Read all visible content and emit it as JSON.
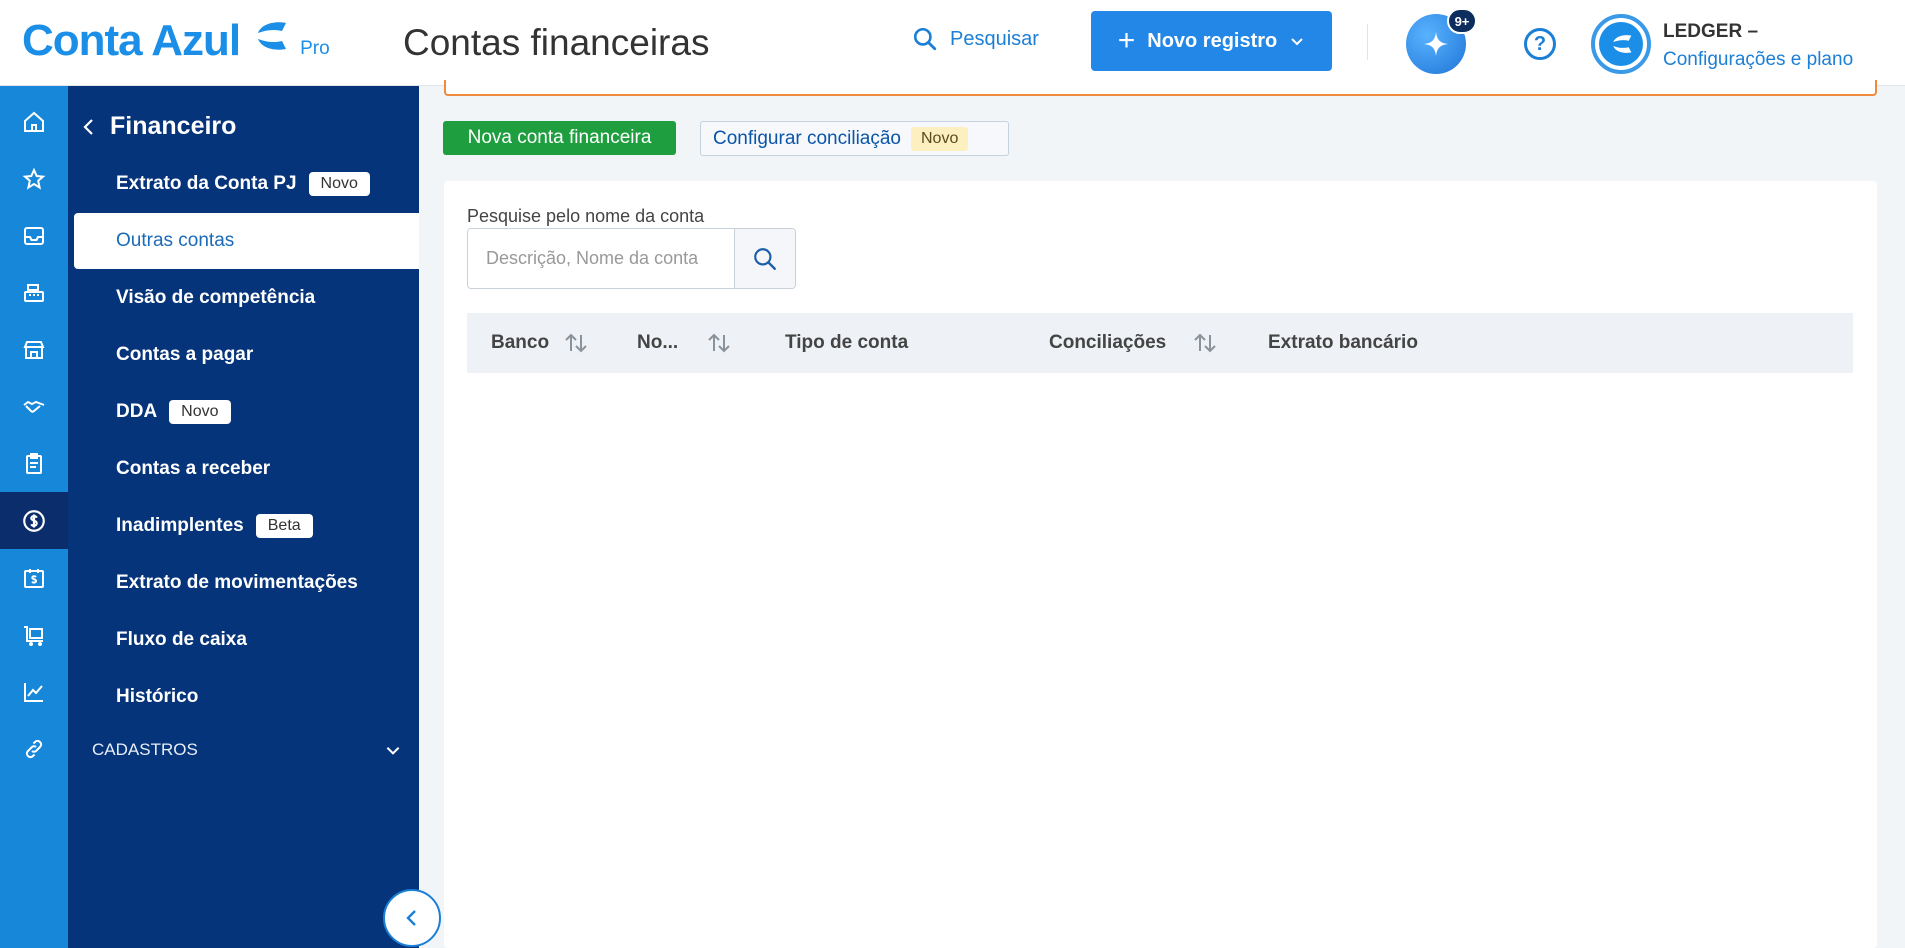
{
  "brand": {
    "name": "Conta Azul",
    "plan": "Pro"
  },
  "header": {
    "title": "Contas financeiras",
    "search_label": "Pesquisar",
    "new_record_label": "Novo registro",
    "ai_badge": "9+",
    "help_symbol": "?",
    "user_name": "LEDGER –",
    "user_link": "Configurações e plano"
  },
  "rail": {
    "icons": [
      "home-icon",
      "star-icon",
      "inbox-icon",
      "cash-register-icon",
      "store-icon",
      "handshake-icon",
      "clipboard-icon",
      "dollar-circle-icon",
      "calendar-dollar-icon",
      "cart-icon",
      "chart-icon",
      "link-icon"
    ],
    "active": "dollar-circle-icon"
  },
  "sidebar": {
    "title": "Financeiro",
    "items": [
      {
        "label": "Extrato da Conta PJ",
        "badge": "Novo"
      },
      {
        "label": "Outras contas",
        "badge": ""
      },
      {
        "label": "Visão de competência",
        "badge": ""
      },
      {
        "label": "Contas a pagar",
        "badge": ""
      },
      {
        "label": "DDA",
        "badge": "Novo"
      },
      {
        "label": "Contas a receber",
        "badge": ""
      },
      {
        "label": "Inadimplentes",
        "badge": "Beta"
      },
      {
        "label": "Extrato de movimentações",
        "badge": ""
      },
      {
        "label": "Fluxo de caixa",
        "badge": ""
      },
      {
        "label": "Histórico",
        "badge": ""
      }
    ],
    "active_item": "Outras contas",
    "section_label": "CADASTROS"
  },
  "actions": {
    "new_account_label": "Nova conta financeira",
    "configure_label": "Configurar conciliação",
    "configure_badge": "Novo"
  },
  "search": {
    "label": "Pesquise pelo nome da conta",
    "placeholder": "Descrição, Nome da conta",
    "value": ""
  },
  "table": {
    "columns": [
      {
        "label": "Banco",
        "sortable": true
      },
      {
        "label": "No...",
        "sortable": true
      },
      {
        "label": "Tipo de conta",
        "sortable": false
      },
      {
        "label": "Conciliações",
        "sortable": true
      },
      {
        "label": "Extrato bancário",
        "sortable": false
      }
    ],
    "rows": []
  },
  "colors": {
    "brand_blue": "#1b8ee8",
    "primary_button": "#2287e6",
    "sidebar_bg": "#06347a",
    "rail_bg": "#1788d9",
    "success_green": "#1f9e3f",
    "warning_orange": "#f08a3c"
  }
}
